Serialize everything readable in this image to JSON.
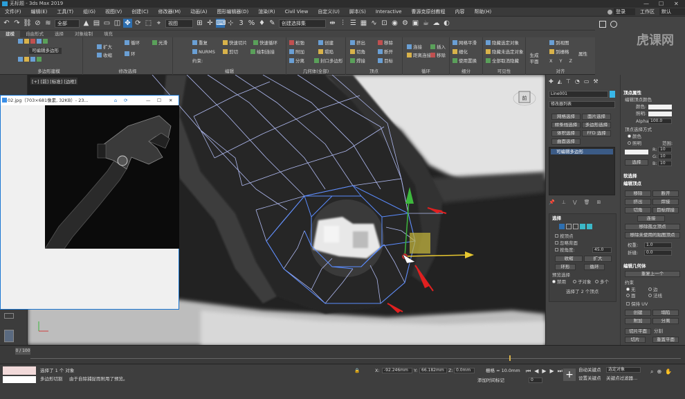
{
  "title": {
    "icon": "3dsmax-icon",
    "text": "无标题 - 3ds Max 2019",
    "minimize": "—",
    "maximize": "☐",
    "close": "✕"
  },
  "menu": {
    "items": [
      "文件(F)",
      "编辑(E)",
      "工具(T)",
      "组(G)",
      "视图(V)",
      "创建(C)",
      "修改器(M)",
      "动画(A)",
      "图形编辑器(D)",
      "渲染(R)",
      "Civil View",
      "自定义(U)",
      "脚本(S)",
      "Interactive",
      "曹源克原创教程",
      "内容",
      "帮助(H)"
    ],
    "user": "登录",
    "workspace": "工作区",
    "workspace_value": "默认"
  },
  "toolbar": {
    "filter": "全部",
    "refcoord": "视图",
    "selset": "创建选择集",
    "snap_angle": "3",
    "snap_pct": "%"
  },
  "ribbon": {
    "tabs": [
      "建模",
      "自由形式",
      "选择",
      "对象绘制",
      "填充"
    ],
    "mode_label": "可编辑多边形",
    "groups": {
      "poly": "多边形建模",
      "modsel": "修改选择",
      "edit": "编辑",
      "geom": "几何体(全部)",
      "vertex": "顶点",
      "loops": "循环",
      "subdiv": "细分",
      "vis": "可见性",
      "align": "对齐"
    },
    "items": {
      "grow": "扩大",
      "shrink": "收缩",
      "loop": "循环",
      "ring": "环",
      "smooth": "光滑",
      "repeat": "重复",
      "quickslice": "快速切片",
      "quickloop": "快速循环",
      "nurms": "NURMS",
      "cut": "剪切",
      "paintconnect": "绘制连接",
      "constraints": "约束:",
      "relax": "松弛",
      "create": "创建",
      "attach": "附加",
      "collapse": "塌陷",
      "detach": "分离",
      "capPoly": "封口多边形",
      "extrude": "挤出",
      "chamfer": "切角",
      "weld": "焊接",
      "remove": "移除",
      "break": "断开",
      "target": "目标",
      "connect": "连接",
      "distconnect": "距离连接",
      "insert": "插入",
      "rmloop": "移除",
      "meshsmooth": "网格平滑",
      "tessellate": "细化",
      "useDisp": "使用置换",
      "hideSel": "隐藏选定对象",
      "hideUnsel": "隐藏未选定对象",
      "unhideAll": "全部取消隐藏",
      "genPlane": "生成平面",
      "toView": "到视图",
      "toGrid": "到栅格",
      "xyz": "X Y Z",
      "props": "属性"
    }
  },
  "viewport": {
    "label": "[+] [前] [标准] [边框]",
    "viewcube_face": "前"
  },
  "imageWindow": {
    "title": "02.jpg（703×681像素, 32KB）- 23...",
    "min": "—",
    "max": "☐",
    "close": "✕"
  },
  "cmdPanel": {
    "objName": "Line001",
    "modlist": "修改器列表",
    "buttons": [
      "网格选择",
      "面片选择",
      "样条线选择",
      "多边形选择",
      "体积选择",
      "FFD 选择",
      "曲面选择"
    ],
    "stack_item": "可编辑多边形",
    "selection": {
      "header": "选择",
      "byVertex": "按顶点",
      "ignoreBack": "忽略背面",
      "byAngle": "按角度:",
      "angle": "45.0",
      "shrink": "收缩",
      "grow": "扩大",
      "ring": "环形",
      "loop": "循环",
      "preview": "预览选择",
      "disabled": "禁用",
      "subobj": "子对象",
      "multi": "多个",
      "status": "选择了 2 个顶点"
    }
  },
  "farPanel": {
    "vertexProps": "顶点属性",
    "editVertexColor": "编辑顶点颜色",
    "color": "颜色:",
    "illum": "照明:",
    "alpha": "Alpha:",
    "alpha_val": "100.0",
    "vertexSelBy": "顶点选择方式",
    "byColor": "颜色",
    "byIllum": "照明",
    "range": "范围:",
    "r": "R:",
    "g": "G:",
    "b": "B:",
    "rv": "10",
    "gv": "10",
    "bv": "10",
    "select": "选择",
    "softSel": "软选择",
    "editVerts": "编辑顶点",
    "remove": "移除",
    "break": "断开",
    "extrude": "挤出",
    "weld": "焊接",
    "chamfer": "切角",
    "targetWeld": "目标焊接",
    "connect": "连接",
    "removeIso": "移除孤立顶点",
    "removeUnused": "移除未使用的贴图顶点",
    "weight": "权重:",
    "weight_val": "1.0",
    "crease": "折缝:",
    "crease_val": "0.0",
    "editGeom": "编辑几何体",
    "repeatLast": "重复上一个",
    "constraints": "约束",
    "none": "无",
    "edge": "边",
    "face": "面",
    "normal": "法线",
    "preserveUV": "保持 UV",
    "create": "创建",
    "collapse": "塌陷",
    "attach": "附加",
    "detach": "分离",
    "slicePlane": "切片平面",
    "split": "分割",
    "slice": "切片",
    "resetPlane": "重置平面"
  },
  "timeline": {
    "frame": "0 / 100"
  },
  "status": {
    "selected": "选择了 1 个 对象",
    "prompt": "由于自除捕捉而附用了预览。",
    "mode": "多边形切割",
    "x": "-92.246mm",
    "y": "66.182mm",
    "z": "0.0mm",
    "grid": "栅格 = 10.0mm",
    "autokey": "自动关键点",
    "selobj": "选定对象",
    "setkey": "设置关键点",
    "filters": "关键点过滤器...",
    "addtime": "添加时间标记",
    "frame": "0"
  }
}
